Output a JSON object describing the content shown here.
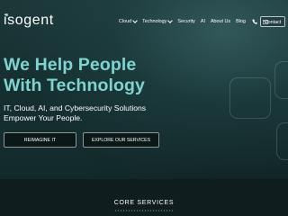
{
  "brand": {
    "name": "isogent"
  },
  "nav": {
    "items": [
      {
        "label": "Cloud",
        "has_dropdown": true
      },
      {
        "label": "Technology",
        "has_dropdown": true
      },
      {
        "label": "Security",
        "has_dropdown": false
      },
      {
        "label": "AI",
        "has_dropdown": false
      },
      {
        "label": "About Us",
        "has_dropdown": false
      },
      {
        "label": "Blog",
        "has_dropdown": false
      }
    ],
    "icons": [
      "phone-icon",
      "mail-icon"
    ],
    "contact_label": "Contact"
  },
  "hero": {
    "headline_line1": "We Help People",
    "headline_line2": "With Technology",
    "subhead_line1": "IT, Cloud, AI, and Cybersecurity Solutions",
    "subhead_line2": "Empower Your People.",
    "primary_button": "REIMAGINE IT",
    "secondary_button": "EXPLORE OUR SERVICES"
  },
  "section": {
    "title": "CORE SERVICES"
  },
  "colors": {
    "accent": "#7fd3d0",
    "background": "#173132",
    "section_background": "#101d1e"
  }
}
